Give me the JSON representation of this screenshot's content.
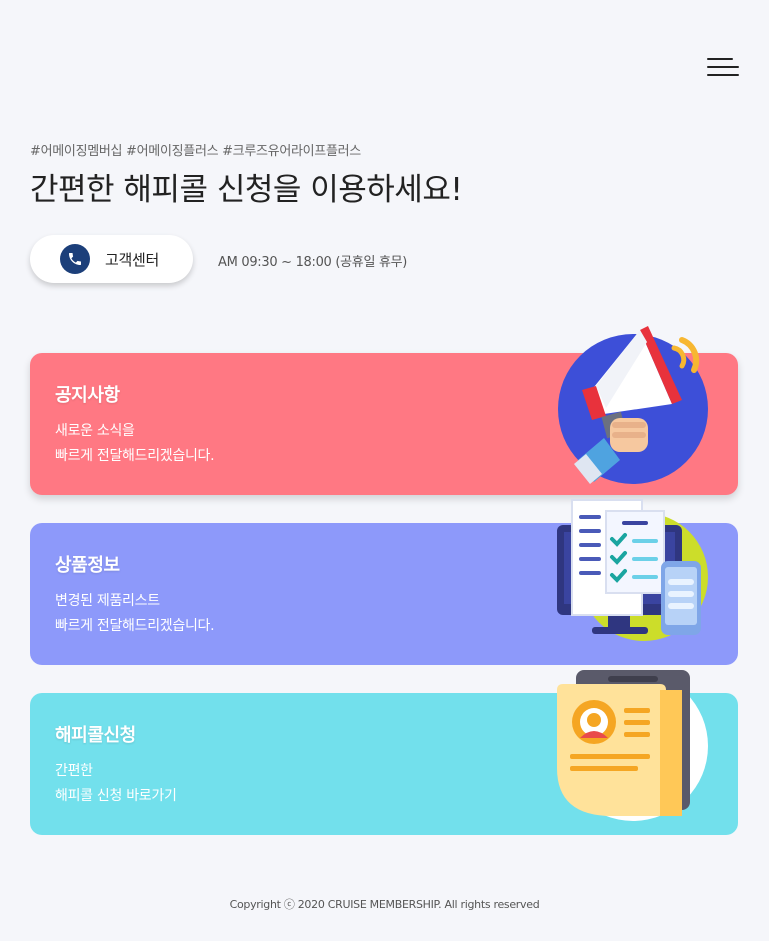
{
  "header": {
    "menu_icon": "hamburger-menu-icon"
  },
  "intro": {
    "hashtags": "#어메이징멤버십 #어메이징플러스 #크루즈유어라이프플러스",
    "headline": "간편한 해피콜 신청을 이용하세요!",
    "customer_center_label": "고객센터",
    "customer_center_icon": "phone-icon",
    "hours": "AM 09:30 ~ 18:00 (공휴일 휴무)"
  },
  "cards": [
    {
      "title": "공지사항",
      "line1": "새로운 소식을",
      "line2": "빠르게 전달해드리겠습니다.",
      "color": "#ff7883",
      "icon": "megaphone-icon"
    },
    {
      "title": "상품정보",
      "line1": "변경된 제품리스트",
      "line2": "빠르게 전달해드리겠습니다.",
      "color": "#8d99fa",
      "icon": "product-list-monitor-icon"
    },
    {
      "title": "해피콜신청",
      "line1": "간편한",
      "line2": "해피콜 신청 바로가기",
      "color": "#72e0ec",
      "icon": "profile-document-icon"
    }
  ],
  "footer": {
    "copyright": "Copyright ⓒ 2020 CRUISE MEMBERSHIP. All rights reserved"
  }
}
